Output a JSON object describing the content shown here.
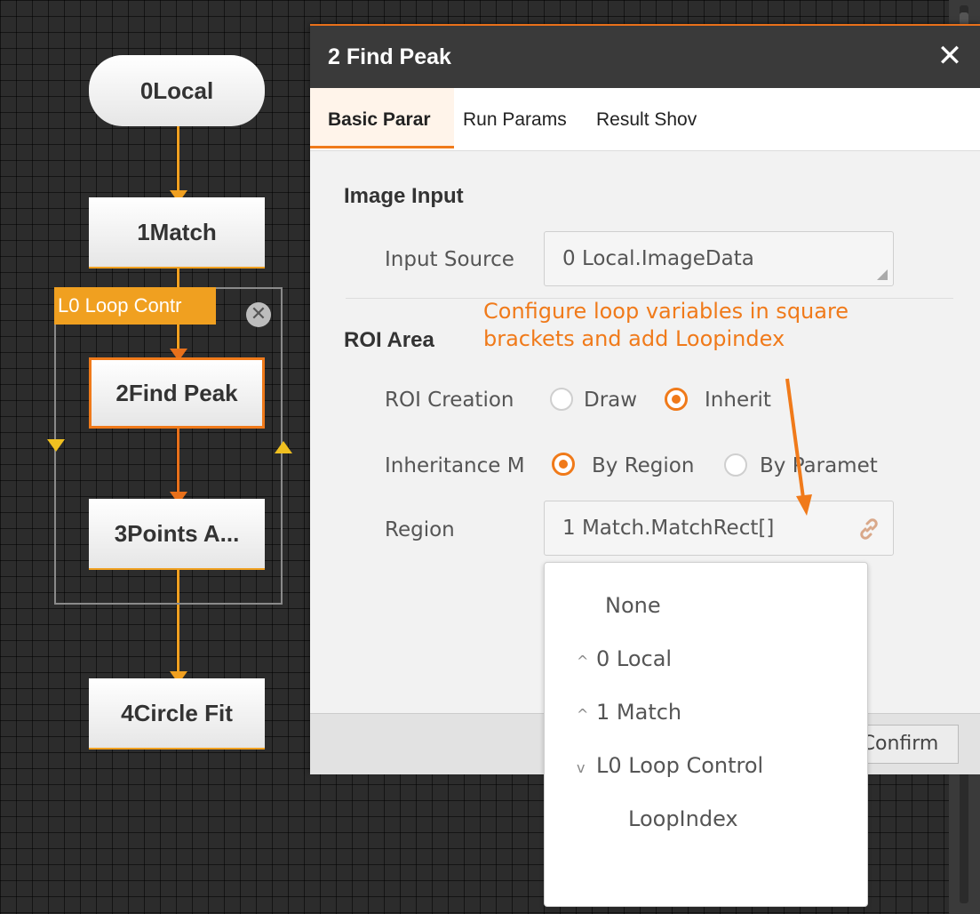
{
  "flow": {
    "nodes": [
      "0Local",
      "1Match",
      "2Find Peak",
      "3Points A...",
      "4Circle Fit"
    ],
    "loop_label": "L0 Loop Contr",
    "loop_close_glyph": "✕",
    "colors": {
      "wire": "#f0a020",
      "selected": "#f07a1a"
    }
  },
  "dialog": {
    "title": "2 Find Peak",
    "close_glyph": "✕",
    "tabs": [
      "Basic Parar",
      "Run Params",
      "Result Shov"
    ],
    "image_input": {
      "title": "Image Input",
      "input_source_label": "Input Source",
      "input_source_value": "0 Local.ImageData"
    },
    "roi": {
      "title": "ROI Area",
      "annotation": "Configure loop variables in square brackets and add Loopindex",
      "creation_label": "ROI Creation",
      "creation_options": [
        "Draw",
        "Inherit"
      ],
      "creation_selected": "Inherit",
      "inheritance_label": "Inheritance M",
      "inheritance_options": [
        "By Region",
        "By Paramet"
      ],
      "inheritance_selected": "By Region",
      "region_label": "Region",
      "region_value": "1 Match.MatchRect[]",
      "region_icon": "link-icon"
    },
    "confirm_label": "Confirm"
  },
  "dropdown": {
    "items": [
      "None",
      "0 Local",
      "1 Match",
      "L0 Loop Control",
      "LoopIndex"
    ]
  }
}
